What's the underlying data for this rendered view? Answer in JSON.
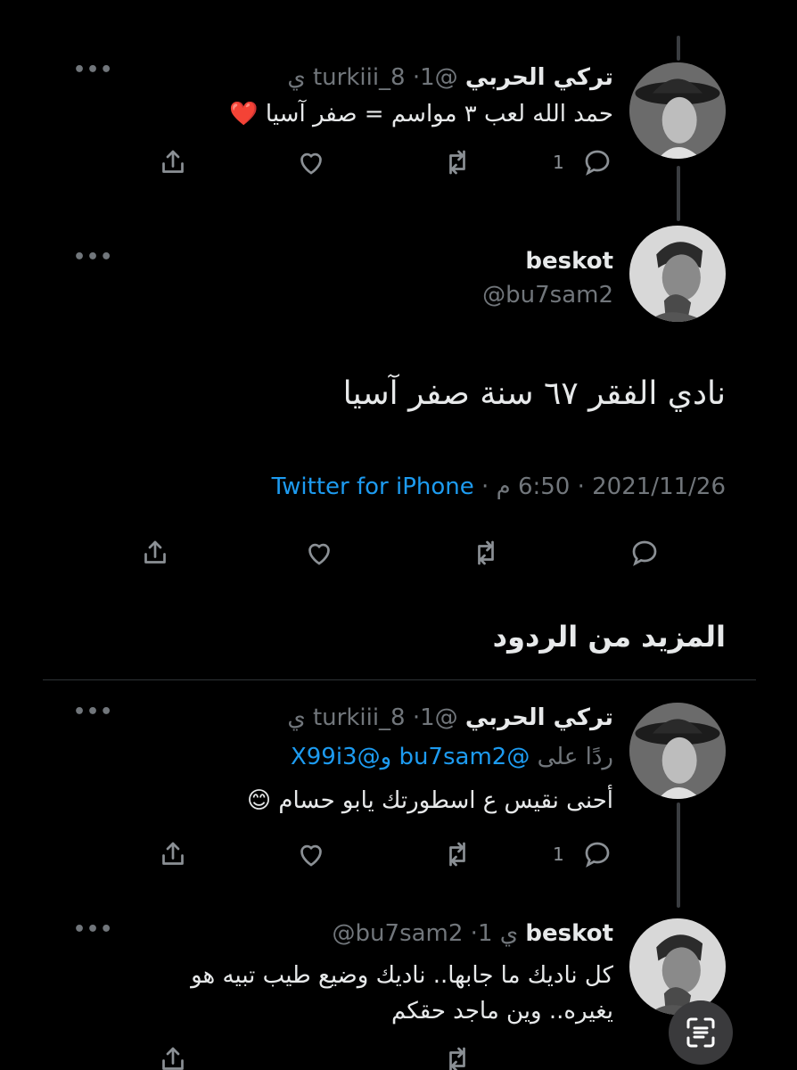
{
  "tweet1": {
    "name": "تركي الحربي",
    "handle_time": "@turkiii_8 ·1 ي",
    "text": "حمد الله لعب ٣ مواسم = صفر آسيا ❤️",
    "reply_count": "1"
  },
  "main_tweet": {
    "name": "beskot",
    "handle": "@bu7sam2",
    "text": "نادي الفقر ٦٧ سنة صفر آسيا",
    "date_time": "2021/11/26 · 6:50 م ·",
    "source": "Twitter for iPhone"
  },
  "section": {
    "title": "المزيد من الردود"
  },
  "reply1": {
    "name": "تركي الحربي",
    "handle_time": "@turkiii_8 ·1 ي",
    "replying_prefix": "ردًا على",
    "replying_users": "@bu7sam2 و@X99i3",
    "text": "أحنى نقيس ع اسطورتك يابو حسام 😊",
    "reply_count": "1"
  },
  "reply2": {
    "name": "beskot",
    "handle_time": "@bu7sam2 ·1 ي",
    "text_line1": "كل ناديك ما جابها.. ناديك وضيع طيب تبيه هو",
    "text_line2": "يغيره.. وين ماجد حقكم"
  },
  "icons": {
    "more": "more-dots-icon",
    "reply": "reply-bubble-icon",
    "retweet": "retweet-icon",
    "like": "heart-icon",
    "share": "share-icon",
    "scan": "text-scan-icon"
  },
  "colors": {
    "background": "#000000",
    "text": "#e7e9ea",
    "muted": "#71767b",
    "link": "#1d9bf0"
  }
}
